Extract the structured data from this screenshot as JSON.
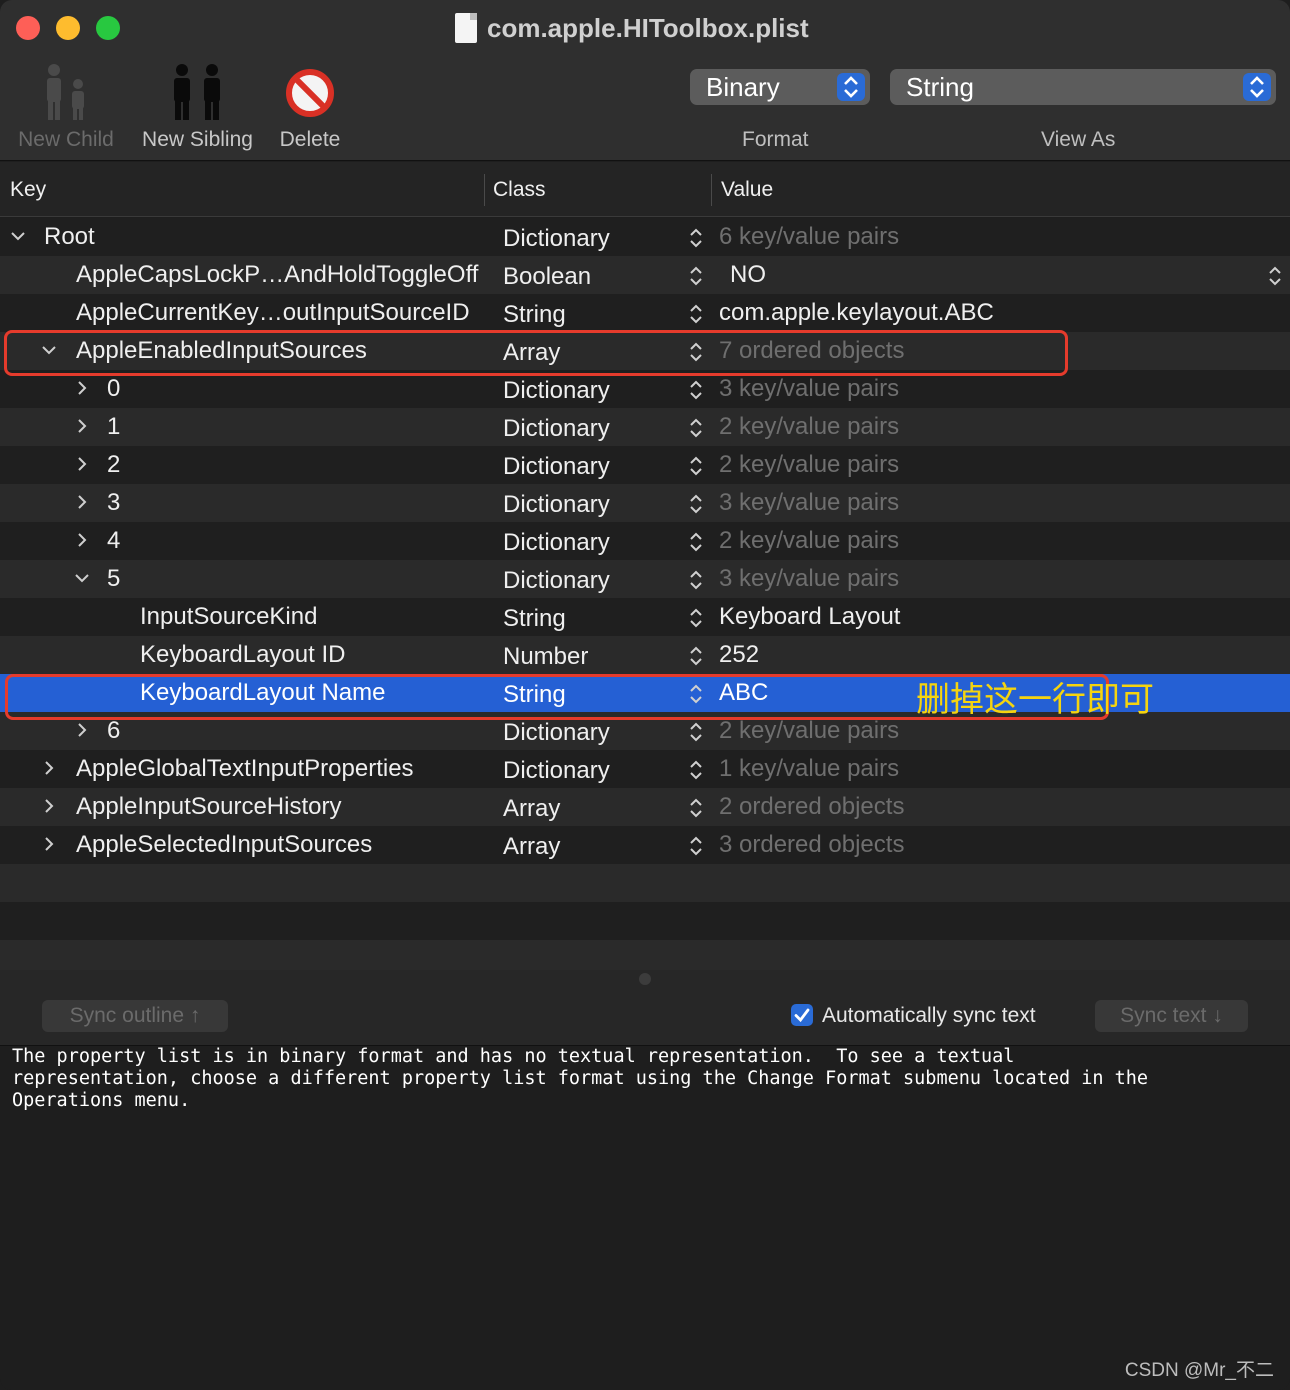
{
  "window": {
    "title": "com.apple.HIToolbox.plist"
  },
  "toolbar": {
    "new_child_label": "New Child",
    "new_sibling_label": "New Sibling",
    "delete_label": "Delete",
    "format_value": "Binary",
    "format_caption": "Format",
    "view_as_value": "String",
    "view_as_caption": "View As"
  },
  "table": {
    "headers": {
      "key": "Key",
      "class": "Class",
      "value": "Value"
    },
    "rows": [
      {
        "key": "Root",
        "class": "Dictionary",
        "value": "6 key/value pairs",
        "level": 0,
        "disclosure": "expanded",
        "muted": true
      },
      {
        "key": "AppleCapsLockP…AndHoldToggleOff",
        "class": "Boolean",
        "value": "NO",
        "level": 1,
        "disclosure": "none",
        "muted": false
      },
      {
        "key": "AppleCurrentKey…outInputSourceID",
        "class": "String",
        "value": "com.apple.keylayout.ABC",
        "level": 1,
        "disclosure": "none",
        "muted": false
      },
      {
        "key": "AppleEnabledInputSources",
        "class": "Array",
        "value": "7 ordered objects",
        "level": 1,
        "disclosure": "expanded",
        "muted": true
      },
      {
        "key": "0",
        "class": "Dictionary",
        "value": "3 key/value pairs",
        "level": 2,
        "disclosure": "collapsed",
        "muted": true
      },
      {
        "key": "1",
        "class": "Dictionary",
        "value": "2 key/value pairs",
        "level": 2,
        "disclosure": "collapsed",
        "muted": true
      },
      {
        "key": "2",
        "class": "Dictionary",
        "value": "2 key/value pairs",
        "level": 2,
        "disclosure": "collapsed",
        "muted": true
      },
      {
        "key": "3",
        "class": "Dictionary",
        "value": "3 key/value pairs",
        "level": 2,
        "disclosure": "collapsed",
        "muted": true
      },
      {
        "key": "4",
        "class": "Dictionary",
        "value": "2 key/value pairs",
        "level": 2,
        "disclosure": "collapsed",
        "muted": true
      },
      {
        "key": "5",
        "class": "Dictionary",
        "value": "3 key/value pairs",
        "level": 2,
        "disclosure": "expanded",
        "muted": true
      },
      {
        "key": "InputSourceKind",
        "class": "String",
        "value": "Keyboard Layout",
        "level": 3,
        "disclosure": "none",
        "muted": false
      },
      {
        "key": "KeyboardLayout ID",
        "class": "Number",
        "value": "252",
        "level": 3,
        "disclosure": "none",
        "muted": false
      },
      {
        "key": "KeyboardLayout Name",
        "class": "String",
        "value": "ABC",
        "level": 3,
        "disclosure": "none",
        "muted": false,
        "selected": true
      },
      {
        "key": "6",
        "class": "Dictionary",
        "value": "2 key/value pairs",
        "level": 2,
        "disclosure": "collapsed",
        "muted": true
      },
      {
        "key": "AppleGlobalTextInputProperties",
        "class": "Dictionary",
        "value": "1 key/value pairs",
        "level": 1,
        "disclosure": "collapsed",
        "muted": true
      },
      {
        "key": "AppleInputSourceHistory",
        "class": "Array",
        "value": "2 ordered objects",
        "level": 1,
        "disclosure": "collapsed",
        "muted": true
      },
      {
        "key": "AppleSelectedInputSources",
        "class": "Array",
        "value": "3 ordered objects",
        "level": 1,
        "disclosure": "collapsed",
        "muted": true
      }
    ]
  },
  "annotation": {
    "text": "删掉这一行即可",
    "color": "#f5d40f",
    "highlight_color": "#e53b2c"
  },
  "sync": {
    "sync_outline_label": "Sync outline ↑",
    "auto_sync_label": "Automatically sync text",
    "auto_sync_checked": true,
    "sync_text_label": "Sync text ↓"
  },
  "text_view": {
    "content": "The property list is in binary format and has no textual representation.  To see a textual\nrepresentation, choose a different property list format using the Change Format submenu located in the\nOperations menu."
  },
  "watermark": "CSDN @Mr_不二",
  "colors": {
    "selection": "#2560d4",
    "accent": "#2a6bd6"
  }
}
